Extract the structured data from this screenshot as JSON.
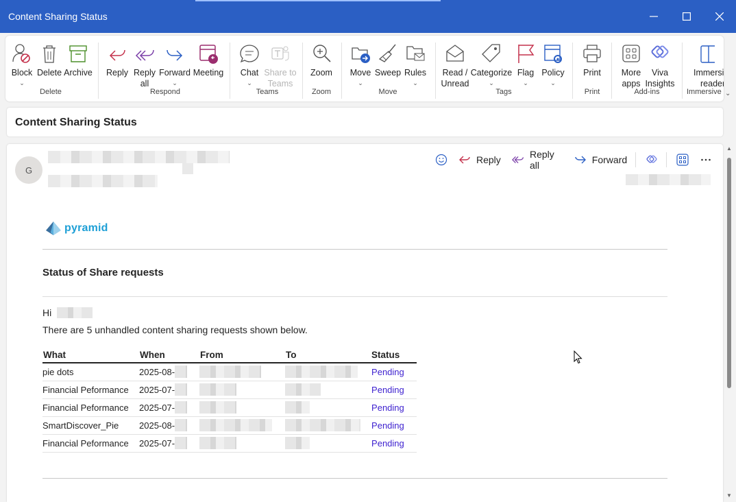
{
  "window": {
    "title": "Content Sharing Status",
    "controls": {
      "minimize": "minimize",
      "maximize": "maximize",
      "close": "close"
    }
  },
  "ribbon": {
    "groups": {
      "delete": "Delete",
      "respond": "Respond",
      "teams": "Teams",
      "zoom": "Zoom",
      "move": "Move",
      "tags": "Tags",
      "print": "Print",
      "addins": "Add-ins",
      "immersive": "Immersive"
    },
    "buttons": {
      "block": "Block",
      "delete": "Delete",
      "archive": "Archive",
      "reply": "Reply",
      "reply_all_1": "Reply",
      "reply_all_2": "all",
      "forward": "Forward",
      "meeting": "Meeting",
      "chat": "Chat",
      "share_teams_1": "Share to",
      "share_teams_2": "Teams",
      "zoom": "Zoom",
      "move": "Move",
      "sweep": "Sweep",
      "rules": "Rules",
      "read_1": "Read /",
      "read_2": "Unread",
      "categorize": "Categorize",
      "flag": "Flag",
      "policy": "Policy",
      "print": "Print",
      "more_apps_1": "More",
      "more_apps_2": "apps",
      "viva_1": "Viva",
      "viva_2": "Insights",
      "immersive_1": "Immersive",
      "immersive_2": "reader"
    }
  },
  "subject": "Content Sharing Status",
  "message": {
    "avatar_initial": "G",
    "actions": {
      "reply": "Reply",
      "reply_all": "Reply all",
      "forward": "Forward"
    },
    "logo_text": "pyramid",
    "heading": "Status of Share requests",
    "greeting": "Hi",
    "intro": "There are 5 unhandled content sharing requests shown below.",
    "table": {
      "headers": {
        "what": "What",
        "when": "When",
        "from": "From",
        "to": "To",
        "status": "Status"
      },
      "rows": [
        {
          "what": "pie dots",
          "when": "2025-08-",
          "status": "Pending"
        },
        {
          "what": "Financial Peformance",
          "when": "2025-07-",
          "status": "Pending"
        },
        {
          "what": "Financial Peformance",
          "when": "2025-07-",
          "status": "Pending"
        },
        {
          "what": "SmartDiscover_Pie",
          "when": "2025-08-",
          "status": "Pending"
        },
        {
          "what": "Financial Peformance",
          "when": "2025-07-",
          "status": "Pending"
        }
      ]
    }
  },
  "colors": {
    "titlebar": "#2b5fc4",
    "link": "#3c1fcf",
    "accent_red": "#c4314b",
    "accent_blue": "#2b5fc4",
    "pyramid": "#1d9fd6"
  }
}
